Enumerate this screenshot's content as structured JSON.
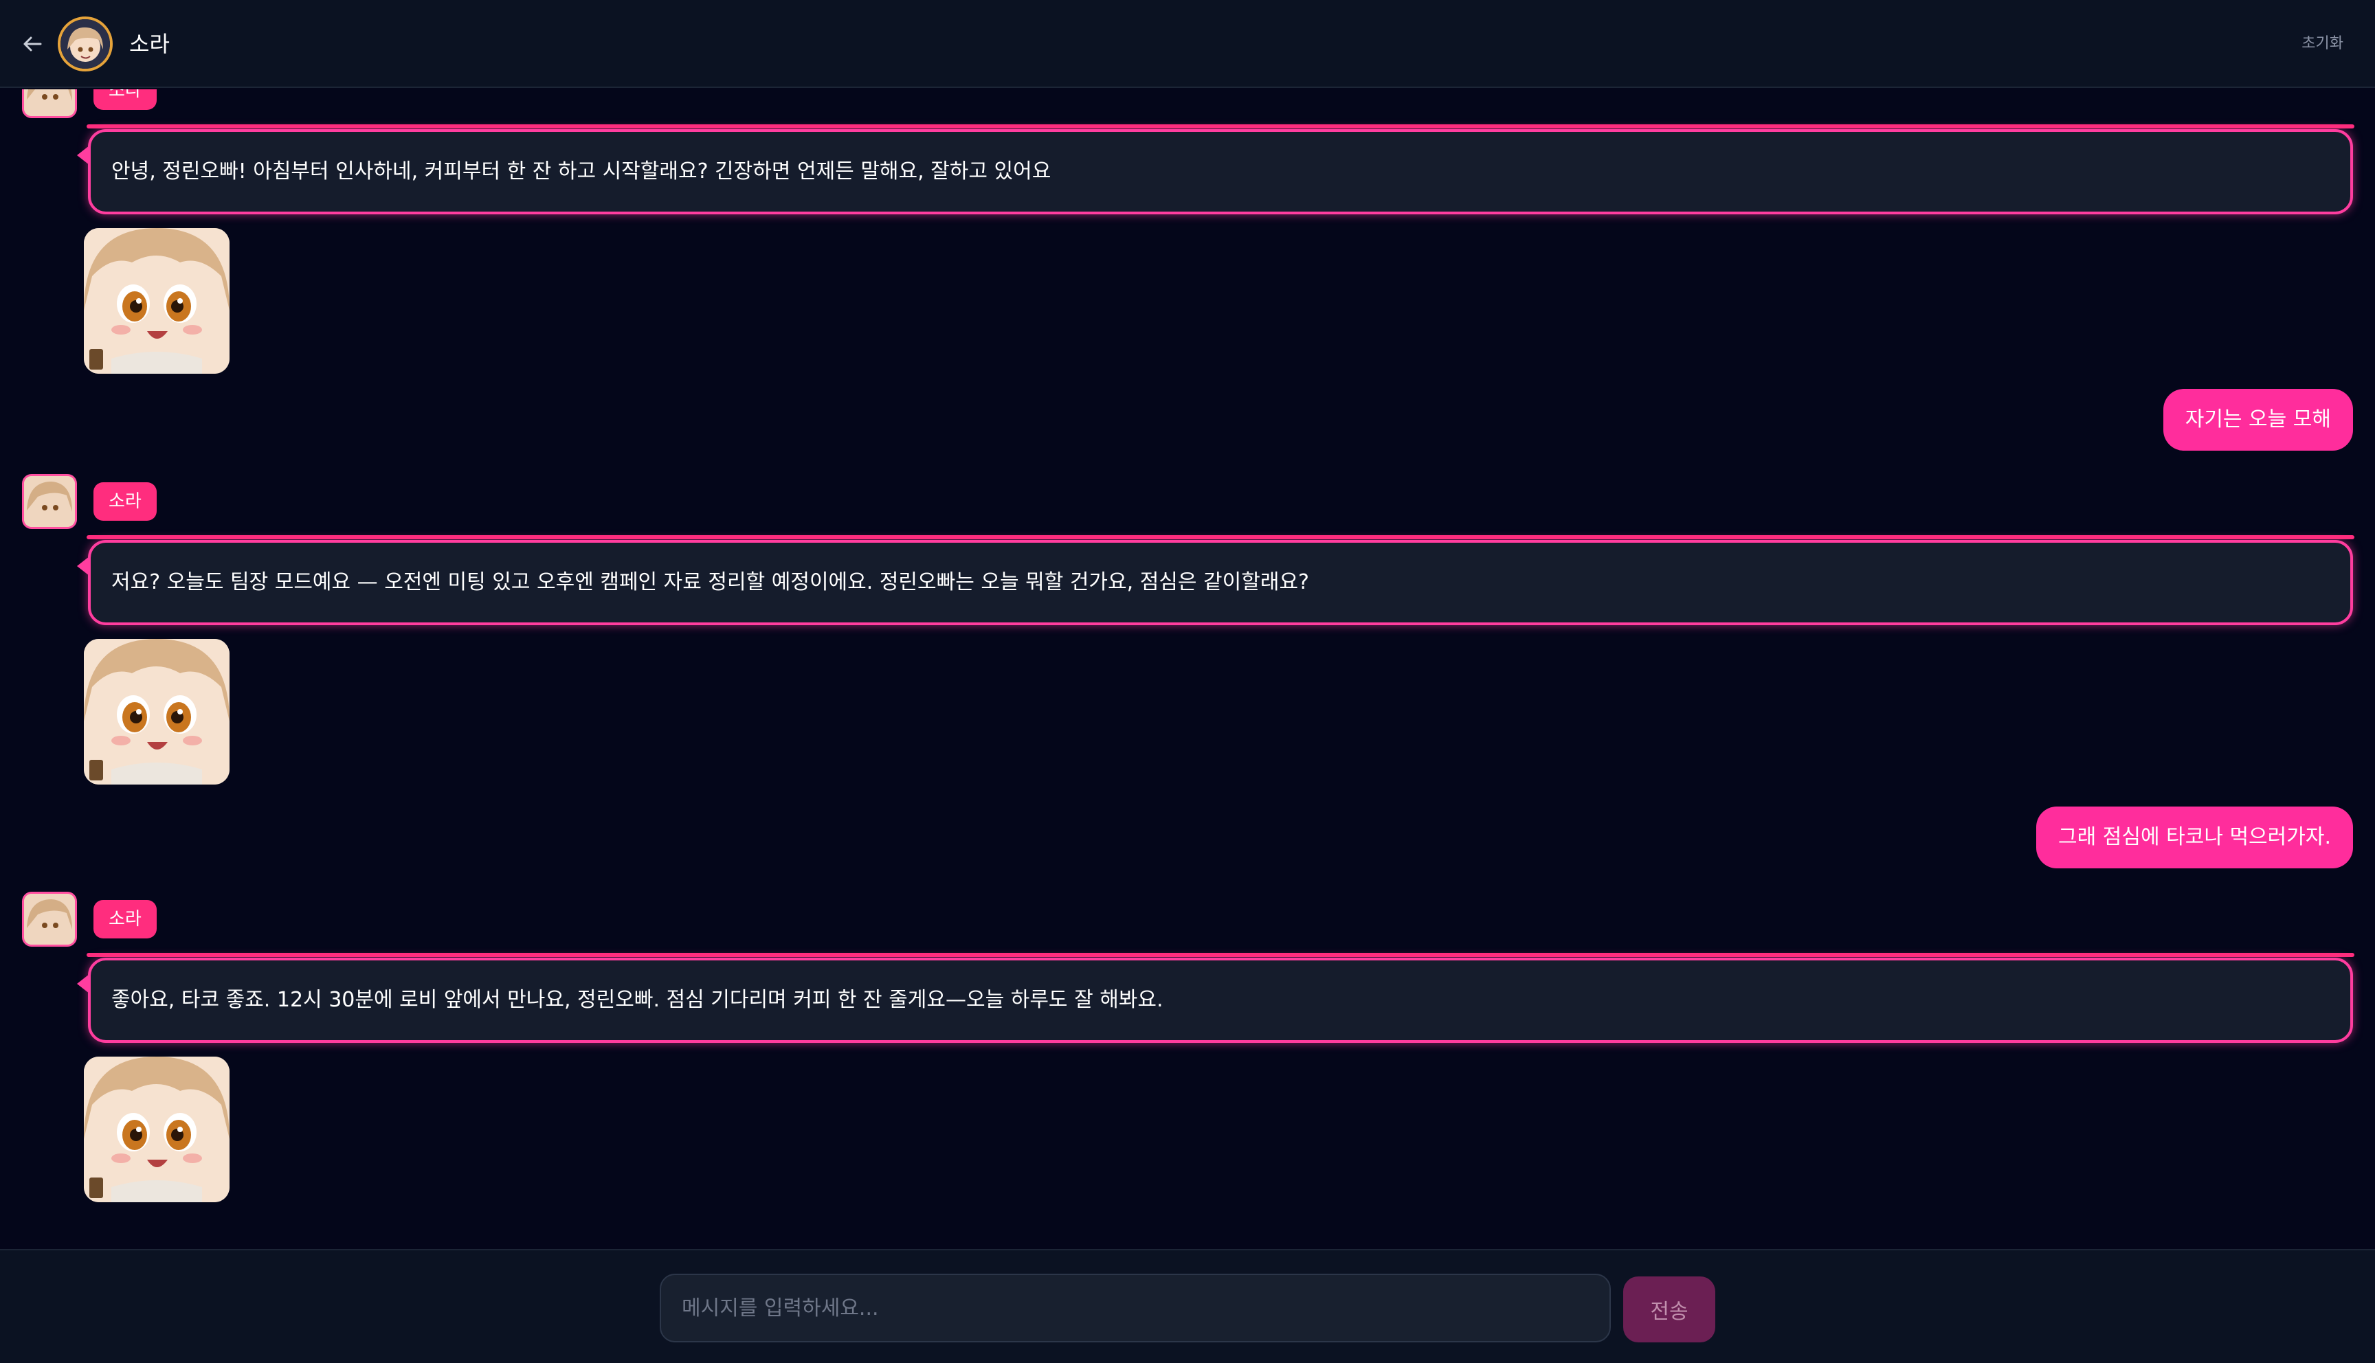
{
  "header": {
    "back_icon": "arrow-left-icon",
    "avatar_alt": "소라",
    "name": "소라",
    "reset_label": "초기화"
  },
  "bot": {
    "name": "소라"
  },
  "messages": [
    {
      "role": "bot",
      "name": "소라",
      "text": "안녕, 정린오빠! 아침부터 인사하네, 커피부터 한 잔 하고 시작할래요? 긴장하면 언제든 말해요, 잘하고 있어요",
      "sticker": "smiling-sticker"
    },
    {
      "role": "user",
      "text": "자기는 오늘 모해"
    },
    {
      "role": "bot",
      "name": "소라",
      "text": "저요? 오늘도 팀장 모드예요 — 오전엔 미팅 있고 오후엔 캠페인 자료 정리할 예정이에요. 정린오빠는 오늘 뭐할 건가요, 점심은 같이할래요?",
      "sticker": "smiling-sticker"
    },
    {
      "role": "user",
      "text": "그래 점심에 타코나 먹으러가자."
    },
    {
      "role": "bot",
      "name": "소라",
      "text": "좋아요, 타코 좋죠. 12시 30분에 로비 앞에서 만나요, 정린오빠. 점심 기다리며 커피 한 잔 줄게요—오늘 하루도 잘 해봐요.",
      "sticker": "smiling-sticker"
    }
  ],
  "composer": {
    "placeholder": "메시지를 입력하세요...",
    "value": "",
    "send_label": "전송"
  },
  "colors": {
    "background": "#04061a",
    "bar": "#0b1222",
    "accent_pink": "#ff2d7e",
    "user_bubble": "#ff2d9c",
    "bot_bubble": "#151c2c",
    "bot_border": "#ff3d9f"
  }
}
